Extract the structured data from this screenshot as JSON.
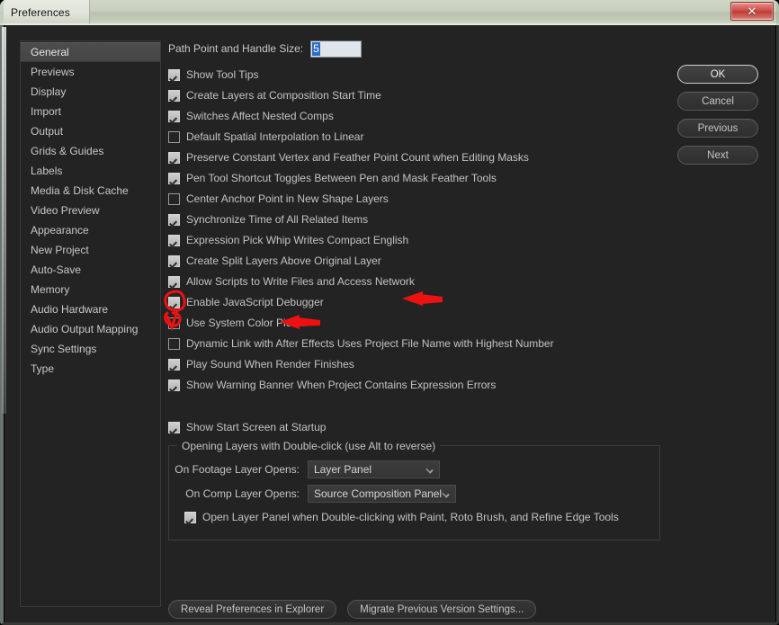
{
  "window": {
    "title": "Preferences",
    "close_glyph": "✕"
  },
  "sidebar": {
    "items": [
      {
        "label": "General",
        "selected": true
      },
      {
        "label": "Previews",
        "selected": false
      },
      {
        "label": "Display",
        "selected": false
      },
      {
        "label": "Import",
        "selected": false
      },
      {
        "label": "Output",
        "selected": false
      },
      {
        "label": "Grids & Guides",
        "selected": false
      },
      {
        "label": "Labels",
        "selected": false
      },
      {
        "label": "Media & Disk Cache",
        "selected": false
      },
      {
        "label": "Video Preview",
        "selected": false
      },
      {
        "label": "Appearance",
        "selected": false
      },
      {
        "label": "New Project",
        "selected": false
      },
      {
        "label": "Auto-Save",
        "selected": false
      },
      {
        "label": "Memory",
        "selected": false
      },
      {
        "label": "Audio Hardware",
        "selected": false
      },
      {
        "label": "Audio Output Mapping",
        "selected": false
      },
      {
        "label": "Sync Settings",
        "selected": false
      },
      {
        "label": "Type",
        "selected": false
      }
    ]
  },
  "main": {
    "path_point": {
      "label": "Path Point and Handle Size:",
      "value": "5",
      "selected": true
    },
    "checkboxes": [
      {
        "label": "Show Tool Tips",
        "checked": true,
        "highlighted": false
      },
      {
        "label": "Create Layers at Composition Start Time",
        "checked": true,
        "highlighted": false
      },
      {
        "label": "Switches Affect Nested Comps",
        "checked": true,
        "highlighted": false
      },
      {
        "label": "Default Spatial Interpolation to Linear",
        "checked": false,
        "highlighted": false
      },
      {
        "label": "Preserve Constant Vertex and Feather Point Count when Editing Masks",
        "checked": true,
        "highlighted": false
      },
      {
        "label": "Pen Tool Shortcut Toggles Between Pen and Mask Feather Tools",
        "checked": true,
        "highlighted": false
      },
      {
        "label": "Center Anchor Point in New Shape Layers",
        "checked": false,
        "highlighted": false
      },
      {
        "label": "Synchronize Time of All Related Items",
        "checked": true,
        "highlighted": false
      },
      {
        "label": "Expression Pick Whip Writes Compact English",
        "checked": true,
        "highlighted": false
      },
      {
        "label": "Create Split Layers Above Original Layer",
        "checked": true,
        "highlighted": false
      },
      {
        "label": "Allow Scripts to Write Files and Access Network",
        "checked": true,
        "highlighted": true
      },
      {
        "label": "Enable JavaScript Debugger",
        "checked": true,
        "highlighted": true
      },
      {
        "label": "Use System Color Picker",
        "checked": false,
        "highlighted": false
      },
      {
        "label": "Dynamic Link with After Effects Uses Project File Name with Highest Number",
        "checked": false,
        "highlighted": false
      },
      {
        "label": "Play Sound When Render Finishes",
        "checked": true,
        "highlighted": false
      },
      {
        "label": "Show Warning Banner When Project Contains Expression Errors",
        "checked": true,
        "highlighted": false
      }
    ],
    "start_screen": {
      "label": "Show Start Screen at Startup",
      "checked": true
    },
    "group": {
      "title": "Opening Layers with Double-click (use Alt to reverse)",
      "footage_label": "On Footage Layer Opens:",
      "footage_value": "Layer Panel",
      "comp_label": "On Comp Layer Opens:",
      "comp_value": "Source Composition Panel",
      "open_layer_panel": {
        "label": "Open Layer Panel when Double-clicking with Paint, Roto Brush, and Refine Edge Tools",
        "checked": true
      }
    },
    "bottom_buttons": [
      {
        "label": "Reveal Preferences in Explorer"
      },
      {
        "label": "Migrate Previous Version Settings..."
      }
    ]
  },
  "right_buttons": [
    {
      "label": "OK",
      "default": true
    },
    {
      "label": "Cancel",
      "default": false
    },
    {
      "label": "Previous",
      "default": false
    },
    {
      "label": "Next",
      "default": false
    }
  ],
  "annotations": {
    "color": "#ee1111",
    "marks": [
      {
        "kind": "circle-highlight",
        "target": "Allow Scripts to Write Files and Access Network"
      },
      {
        "kind": "circle-highlight",
        "target": "Enable JavaScript Debugger"
      },
      {
        "kind": "arrow-left",
        "target": "Allow Scripts to Write Files and Access Network"
      },
      {
        "kind": "arrow-left",
        "target": "Enable JavaScript Debugger"
      }
    ]
  },
  "colors": {
    "dialog_bg": "#232323",
    "text": "#c3c3c3",
    "titlebar": "#c8d0bd",
    "accent_selection": "#2a6ec4",
    "annotation_red": "#ee1111"
  }
}
